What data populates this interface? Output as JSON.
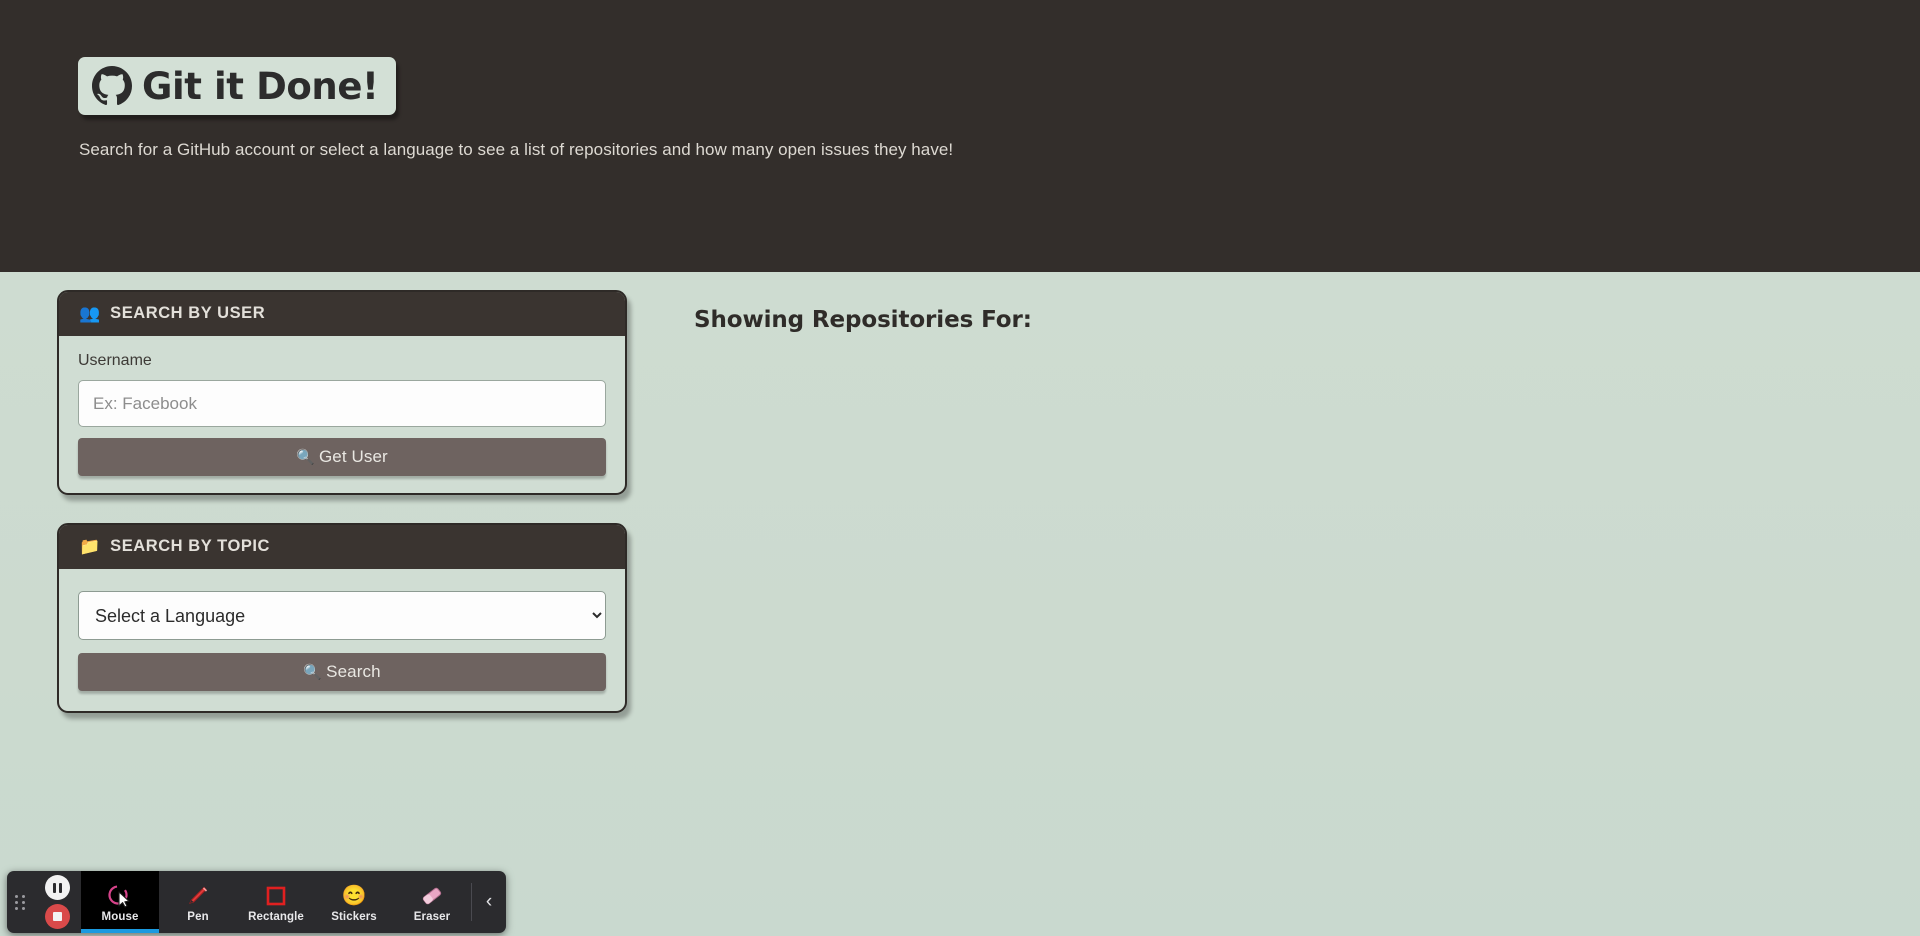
{
  "header": {
    "logo_icon": "github-icon",
    "logo_text": "Git it Done!",
    "subtitle": "Search for a GitHub account or select a language to see a list of repositories and how many open issues they have!"
  },
  "user_card": {
    "icon": "busts-in-silhouette-icon",
    "icon_glyph": "👥",
    "title": "SEARCH BY USER",
    "field_label": "Username",
    "input_value": "",
    "input_placeholder": "Ex: Facebook",
    "button_icon": "🔍",
    "button_label": "Get User"
  },
  "topic_card": {
    "icon": "folder-icon",
    "icon_glyph": "📁",
    "title": "SEARCH BY TOPIC",
    "select_value": "Select a Language",
    "select_options": [
      "Select a Language"
    ],
    "button_icon": "🔍",
    "button_label": "Search"
  },
  "results": {
    "heading": "Showing Repositories For:",
    "items": []
  },
  "toolbar": {
    "drag_handle": "drag-handle",
    "pause_label": "pause-recording",
    "stop_label": "stop-recording",
    "tools": [
      {
        "name": "mouse",
        "label": "Mouse",
        "glyph": "",
        "active": true
      },
      {
        "name": "pen",
        "label": "Pen",
        "glyph": "✏️",
        "active": false
      },
      {
        "name": "rectangle",
        "label": "Rectangle",
        "glyph": "",
        "active": false
      },
      {
        "name": "stickers",
        "label": "Stickers",
        "glyph": "😊",
        "active": false
      },
      {
        "name": "eraser",
        "label": "Eraser",
        "glyph": "",
        "active": false
      }
    ],
    "collapse_glyph": "‹"
  },
  "colors": {
    "header_bg": "#332e2b",
    "page_bg": "#cedcd1",
    "card_header_bg": "#3a3430",
    "button_bg": "#6e6360",
    "accent_blue": "#1a9ae0",
    "record_red": "#d94a4a"
  }
}
